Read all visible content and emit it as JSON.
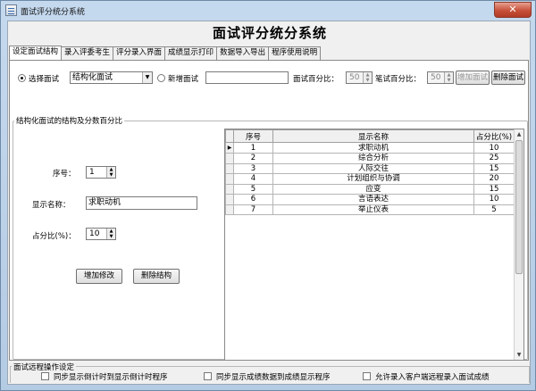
{
  "window": {
    "title": "面试评分统分系统",
    "close_label": "✕"
  },
  "headline": "面试评分统分系统",
  "tabs": [
    {
      "label": "设定面试结构"
    },
    {
      "label": "录入评委考生"
    },
    {
      "label": "评分录入界面"
    },
    {
      "label": "成绩显示打印"
    },
    {
      "label": "数据导入导出"
    },
    {
      "label": "程序使用说明"
    }
  ],
  "mode": {
    "select_label": "选择面试",
    "select_value": "结构化面试",
    "new_label": "新增面试",
    "new_value": "",
    "interview_pct_label": "面试百分比：",
    "interview_pct": "50",
    "written_pct_label": "笔试百分比：",
    "written_pct": "50",
    "add_interview": "增加面试",
    "delete_interview": "删除面试"
  },
  "structure": {
    "group_title": "结构化面试的结构及分数百分比",
    "seq_label": "序号：",
    "seq_value": "1",
    "name_label": "显示名称：",
    "name_value": "求职动机",
    "pct_label": "占分比(%)：",
    "pct_value": "10",
    "add_modify": "增加修改",
    "delete_structure": "删除结构"
  },
  "table": {
    "headers": [
      "序号",
      "显示名称",
      "占分比(%)"
    ],
    "rows": [
      {
        "no": "1",
        "name": "求职动机",
        "pct": "10"
      },
      {
        "no": "2",
        "name": "综合分析",
        "pct": "25"
      },
      {
        "no": "3",
        "name": "人际交往",
        "pct": "15"
      },
      {
        "no": "4",
        "name": "计划组织与协调",
        "pct": "20"
      },
      {
        "no": "5",
        "name": "应变",
        "pct": "15"
      },
      {
        "no": "6",
        "name": "言语表达",
        "pct": "10"
      },
      {
        "no": "7",
        "name": "举止仪表",
        "pct": "5"
      }
    ]
  },
  "remote": {
    "group_title": "面试远程操作设定",
    "opt1": "同步显示倒计时到显示倒计时程序",
    "opt2": "同步显示成绩数据到成绩显示程序",
    "opt3": "允许录入客户端远程录入面试成绩"
  }
}
